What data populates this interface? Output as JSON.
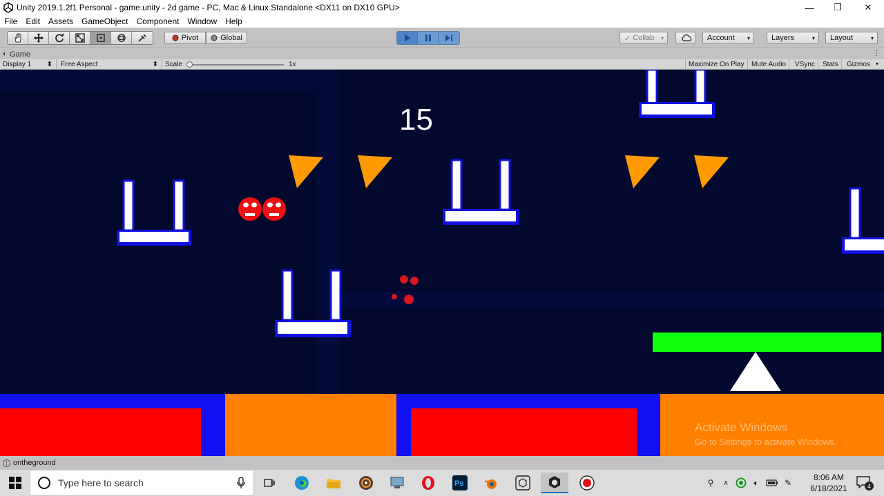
{
  "window": {
    "title": "Unity 2019.1.2f1 Personal - game.unity - 2d game - PC, Mac & Linux Standalone <DX11 on DX10 GPU>",
    "minimize": "—",
    "maximize": "❐",
    "close": "✕"
  },
  "menu": [
    "File",
    "Edit",
    "Assets",
    "GameObject",
    "Component",
    "Window",
    "Help"
  ],
  "toolbar": {
    "pivot_label": "Pivot",
    "global_label": "Global",
    "collab_label": "Collab",
    "account_label": "Account",
    "layers_label": "Layers",
    "layout_label": "Layout"
  },
  "game_tab": {
    "label": "Game",
    "display": "Display 1",
    "aspect": "Free Aspect",
    "scale_label": "Scale",
    "scale_value": "1x",
    "toggles": [
      "Maximize On Play",
      "Mute Audio",
      "VSync",
      "Stats",
      "Gizmos"
    ]
  },
  "game": {
    "score": "15",
    "watermark_title": "Activate Windows",
    "watermark_sub": "Go to Settings to activate Windows.",
    "colors": {
      "background": "#02082e",
      "platform_fill": "#ffffff",
      "platform_border": "#1010e0",
      "spike": "#ff9a00",
      "enemy": "#ee1111",
      "goal_bar": "#11ff11",
      "floor_blue": "#1010f0",
      "floor_red": "#ff0000",
      "floor_orange": "#ff8000"
    }
  },
  "status": {
    "message": "ontheground"
  },
  "taskbar": {
    "search_placeholder": "Type here to search",
    "time": "8:06 AM",
    "date": "6/18/2021",
    "notification_count": "4"
  }
}
